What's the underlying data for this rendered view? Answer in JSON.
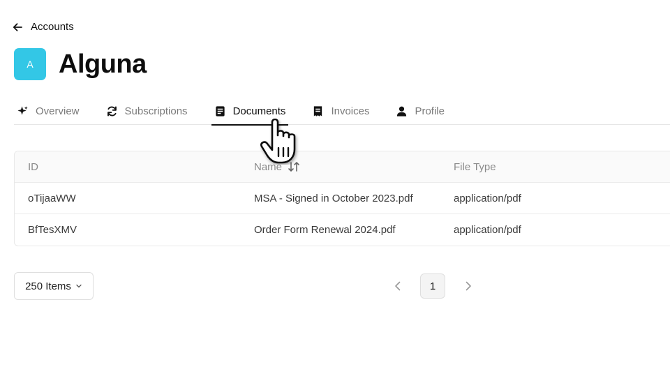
{
  "nav": {
    "back_label": "Accounts"
  },
  "account": {
    "avatar_letter": "A",
    "name": "Alguna"
  },
  "tabs": [
    {
      "label": "Overview",
      "icon": "sparkle-icon"
    },
    {
      "label": "Subscriptions",
      "icon": "refresh-icon"
    },
    {
      "label": "Documents",
      "icon": "document-icon",
      "active": true
    },
    {
      "label": "Invoices",
      "icon": "receipt-icon"
    },
    {
      "label": "Profile",
      "icon": "user-icon"
    }
  ],
  "table": {
    "headers": {
      "id": "ID",
      "name": "Name",
      "file_type": "File Type"
    },
    "rows": [
      {
        "id": "oTijaaWW",
        "name": "MSA - Signed in October 2023.pdf",
        "file_type": "application/pdf"
      },
      {
        "id": "BfTesXMV",
        "name": "Order Form Renewal 2024.pdf",
        "file_type": "application/pdf"
      }
    ]
  },
  "pagination": {
    "page_size": "250 Items",
    "current_page": "1"
  },
  "colors": {
    "avatar": "#33c7e6",
    "active_tab": "#111111",
    "inactive_tab": "#7a7a7a"
  }
}
